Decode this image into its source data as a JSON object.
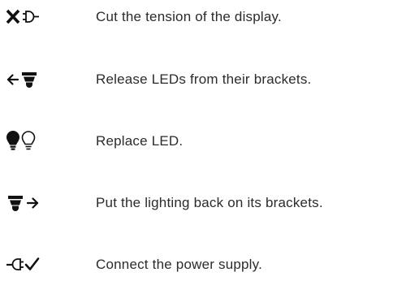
{
  "steps": [
    {
      "icons": [
        "close-icon",
        "plug-icon"
      ],
      "text": "Cut the tension of the display."
    },
    {
      "icons": [
        "arrow-left-icon",
        "led-fixture-icon"
      ],
      "text": "Release LEDs from their brackets."
    },
    {
      "icons": [
        "bulb-filled-icon",
        "bulb-outline-icon"
      ],
      "text": "Replace LED."
    },
    {
      "icons": [
        "led-fixture-icon",
        "arrow-right-icon"
      ],
      "text": "Put the lighting back on its brackets."
    },
    {
      "icons": [
        "plug-icon",
        "checkmark-icon"
      ],
      "text": "Connect the power supply."
    }
  ],
  "colors": {
    "icon": "#111111",
    "text": "#2b2b2b"
  }
}
